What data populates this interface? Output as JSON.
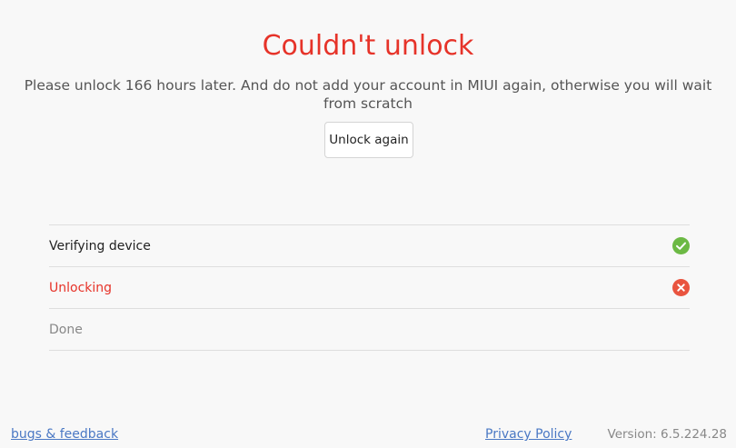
{
  "status": {
    "title": "Couldn't unlock",
    "message": "Please unlock 166 hours later. And do not add your account in MIUI again, otherwise you will wait from scratch",
    "retry_label": "Unlock again"
  },
  "steps": [
    {
      "label": "Verifying device",
      "state": "success",
      "icon": "check-circle-icon"
    },
    {
      "label": "Unlocking",
      "state": "error",
      "icon": "x-circle-icon"
    },
    {
      "label": "Done",
      "state": "pending",
      "icon": ""
    }
  ],
  "footer": {
    "feedback_link": "bugs & feedback",
    "privacy_link": "Privacy Policy",
    "version": "Version: 6.5.224.28"
  },
  "colors": {
    "error": "#e63329",
    "success": "#6cb944",
    "link": "#4a78c4"
  }
}
